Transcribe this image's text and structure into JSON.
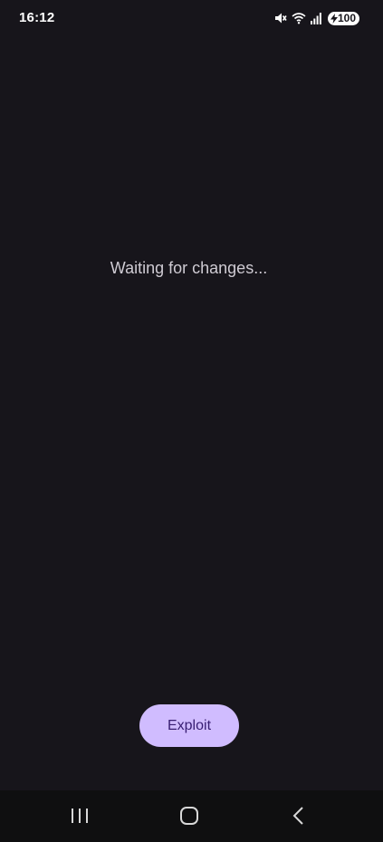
{
  "status_bar": {
    "time": "16:12",
    "battery_level": "100",
    "icons": [
      "mute-icon",
      "wifi-icon",
      "signal-icon",
      "battery-charging-icon"
    ]
  },
  "main": {
    "status_text": "Waiting for changes...",
    "button_label": "Exploit"
  },
  "nav_bar": {
    "icons": [
      "recents-icon",
      "home-icon",
      "back-icon"
    ]
  },
  "colors": {
    "background": "#17151b",
    "button_fill": "#d0bcff",
    "button_text": "#381e72",
    "nav_background": "#0f0f10"
  }
}
